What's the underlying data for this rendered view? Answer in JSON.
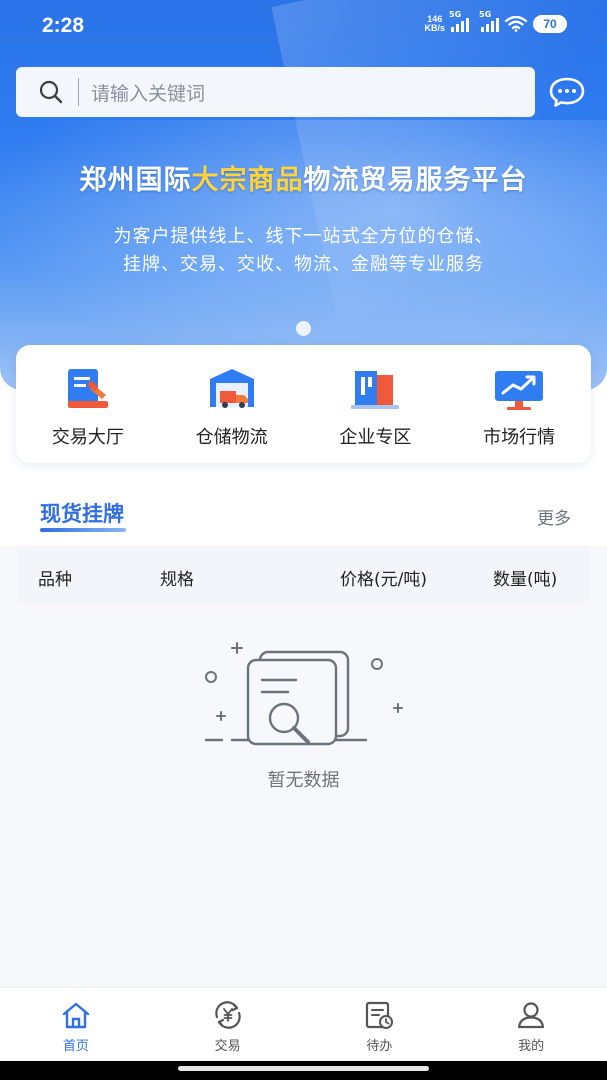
{
  "status_bar": {
    "time": "2:28",
    "net_speed_value": "146",
    "net_speed_unit": "KB/s",
    "signal1_label": "5G",
    "signal2_label": "5G",
    "battery": "70"
  },
  "search": {
    "placeholder": "请输入关键词"
  },
  "banner": {
    "title_part1": "郑州国际",
    "title_highlight": "大宗商品",
    "title_part2": "物流贸易服务平台",
    "subtitle_line1": "为客户提供线上、线下一站式全方位的仓储、",
    "subtitle_line2": "挂牌、交易、交收、物流、金融等专业服务"
  },
  "quick_entries": [
    {
      "label": "交易大厅",
      "icon": "trading-hall-icon"
    },
    {
      "label": "仓储物流",
      "icon": "warehouse-truck-icon"
    },
    {
      "label": "企业专区",
      "icon": "enterprise-icon"
    },
    {
      "label": "市场行情",
      "icon": "market-trend-icon"
    }
  ],
  "spot_listing": {
    "title": "现货挂牌",
    "more": "更多",
    "columns": [
      "品种",
      "规格",
      "价格(元/吨)",
      "数量(吨)"
    ],
    "rows": [],
    "empty_text": "暂无数据"
  },
  "tabbar": {
    "items": [
      {
        "label": "首页",
        "icon": "home-icon",
        "active": true
      },
      {
        "label": "交易",
        "icon": "yuan-exchange-icon",
        "active": false
      },
      {
        "label": "待办",
        "icon": "todo-list-icon",
        "active": false
      },
      {
        "label": "我的",
        "icon": "profile-icon",
        "active": false
      }
    ]
  },
  "colors": {
    "primary": "#2f6fe0",
    "highlight": "#ffd43a",
    "tab_inactive": "#555555"
  }
}
